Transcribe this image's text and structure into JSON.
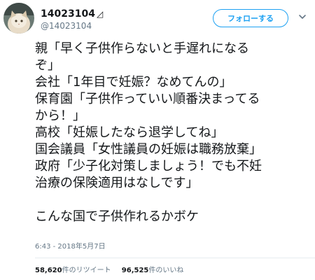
{
  "header": {
    "display_name": "14023104",
    "verified_glyph": "◿",
    "handle": "@14023104",
    "follow_label": "フォローする",
    "avatar_icon": "cat-photo-avatar",
    "menu_icon": "chevron-down-icon"
  },
  "tweet": {
    "lines": [
      "親「早く子供作らないと手遅れになる",
      "ぞ」",
      "会社「1年目で妊娠？なめてんの」",
      "保育園「子供作っていい順番決まってる",
      "から！」",
      "高校「妊娠したなら退学してね」",
      "国会議員「女性議員の妊娠は職務放棄」",
      "政府「少子化対策しましょう！でも不妊",
      "治療の保険適用はなしです」",
      "",
      "こんな国で子供作れるかボケ"
    ],
    "timestamp": "6:43 - 2018年5月7日"
  },
  "stats": {
    "retweets_count": "58,620",
    "retweets_label": "件のリツイート",
    "likes_count": "96,525",
    "likes_label": "件のいいね"
  },
  "colors": {
    "accent": "#1da1f2",
    "text": "#14171a",
    "muted": "#657786",
    "divider": "#e6ecf0"
  }
}
